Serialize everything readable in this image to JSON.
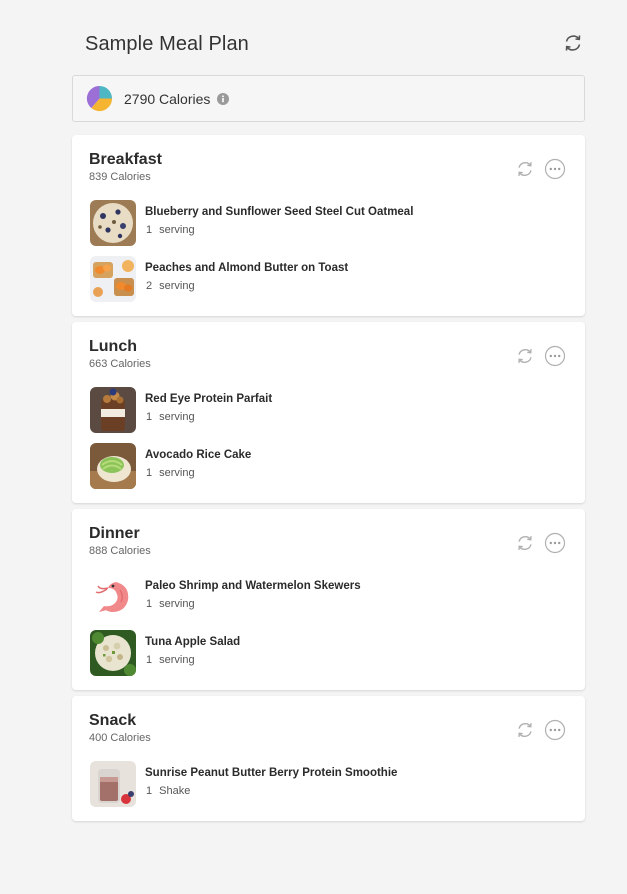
{
  "page": {
    "title": "Sample Meal Plan"
  },
  "summary": {
    "calories": "2790 Calories"
  },
  "meals": [
    {
      "title": "Breakfast",
      "calories": "839 Calories",
      "items": [
        {
          "name": "Blueberry and Sunflower Seed Steel Cut Oatmeal",
          "qty": "1",
          "unit": "serving",
          "image": "oatmeal"
        },
        {
          "name": "Peaches and Almond Butter on Toast",
          "qty": "2",
          "unit": "serving",
          "image": "peach-toast"
        }
      ]
    },
    {
      "title": "Lunch",
      "calories": "663 Calories",
      "items": [
        {
          "name": "Red Eye Protein Parfait",
          "qty": "1",
          "unit": "serving",
          "image": "parfait"
        },
        {
          "name": "Avocado Rice Cake",
          "qty": "1",
          "unit": "serving",
          "image": "avocado-rice-cake"
        }
      ]
    },
    {
      "title": "Dinner",
      "calories": "888 Calories",
      "items": [
        {
          "name": "Paleo Shrimp and Watermelon Skewers",
          "qty": "1",
          "unit": "serving",
          "image": "shrimp"
        },
        {
          "name": "Tuna Apple Salad",
          "qty": "1",
          "unit": "serving",
          "image": "tuna-salad"
        }
      ]
    },
    {
      "title": "Snack",
      "calories": "400 Calories",
      "items": [
        {
          "name": "Sunrise Peanut Butter Berry Protein Smoothie",
          "qty": "1",
          "unit": "Shake",
          "image": "smoothie"
        }
      ]
    }
  ],
  "icons": {
    "regenerate": "refresh-icon",
    "more": "more-options-icon",
    "info": "info-icon",
    "macro_chart": "macro-pie-icon"
  },
  "colors": {
    "pie_purple": "#9b6fd6",
    "pie_teal": "#4db8c4",
    "pie_orange": "#f5b533",
    "icon_gray": "#b0b0b0"
  }
}
